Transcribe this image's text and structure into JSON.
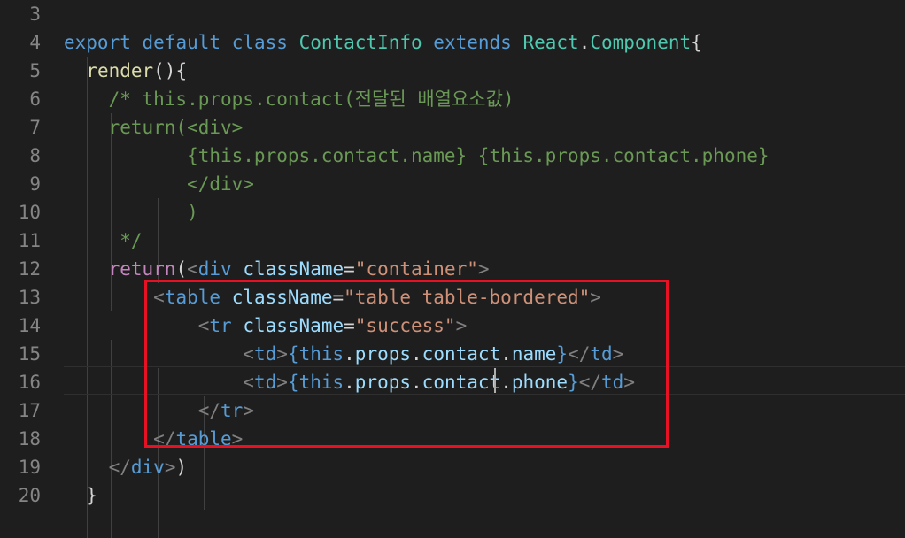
{
  "editor": {
    "lines": [
      {
        "num": "3",
        "tokens": []
      },
      {
        "num": "4",
        "tokens": [
          {
            "t": "export",
            "c": "kw"
          },
          {
            "t": " ",
            "c": "plain"
          },
          {
            "t": "default",
            "c": "kw"
          },
          {
            "t": " ",
            "c": "plain"
          },
          {
            "t": "class",
            "c": "kw"
          },
          {
            "t": " ",
            "c": "plain"
          },
          {
            "t": "ContactInfo",
            "c": "cls"
          },
          {
            "t": " ",
            "c": "plain"
          },
          {
            "t": "extends",
            "c": "kw"
          },
          {
            "t": " ",
            "c": "plain"
          },
          {
            "t": "React",
            "c": "cls"
          },
          {
            "t": ".",
            "c": "plain"
          },
          {
            "t": "Component",
            "c": "cls"
          },
          {
            "t": "{",
            "c": "plain"
          }
        ]
      },
      {
        "num": "5",
        "tokens": [
          {
            "t": "  ",
            "c": "plain"
          },
          {
            "t": "render",
            "c": "fn"
          },
          {
            "t": "(){",
            "c": "plain"
          }
        ]
      },
      {
        "num": "6",
        "tokens": [
          {
            "t": "    ",
            "c": "plain"
          },
          {
            "t": "/* this.props.contact(전달된 배열요소값)",
            "c": "cmt"
          }
        ]
      },
      {
        "num": "7",
        "tokens": [
          {
            "t": "    ",
            "c": "plain"
          },
          {
            "t": "return(<div>",
            "c": "cmt"
          }
        ]
      },
      {
        "num": "8",
        "tokens": [
          {
            "t": "           ",
            "c": "plain"
          },
          {
            "t": "{this.props.contact.name} {this.props.contact.phone}",
            "c": "cmt"
          }
        ]
      },
      {
        "num": "9",
        "tokens": [
          {
            "t": "           ",
            "c": "plain"
          },
          {
            "t": "</div>",
            "c": "cmt"
          }
        ]
      },
      {
        "num": "10",
        "tokens": [
          {
            "t": "           ",
            "c": "plain"
          },
          {
            "t": ")",
            "c": "cmt"
          }
        ]
      },
      {
        "num": "11",
        "tokens": [
          {
            "t": "     ",
            "c": "plain"
          },
          {
            "t": "*/",
            "c": "cmt"
          }
        ]
      },
      {
        "num": "12",
        "tokens": [
          {
            "t": "    ",
            "c": "plain"
          },
          {
            "t": "return",
            "c": "ctl"
          },
          {
            "t": "(",
            "c": "plain"
          },
          {
            "t": "<",
            "c": "tagp"
          },
          {
            "t": "div",
            "c": "tag"
          },
          {
            "t": " ",
            "c": "plain"
          },
          {
            "t": "className",
            "c": "attr"
          },
          {
            "t": "=",
            "c": "plain"
          },
          {
            "t": "\"container\"",
            "c": "str"
          },
          {
            "t": ">",
            "c": "tagp"
          }
        ]
      },
      {
        "num": "13",
        "tokens": [
          {
            "t": "        ",
            "c": "plain"
          },
          {
            "t": "<",
            "c": "tagp"
          },
          {
            "t": "table",
            "c": "tag"
          },
          {
            "t": " ",
            "c": "plain"
          },
          {
            "t": "className",
            "c": "attr"
          },
          {
            "t": "=",
            "c": "plain"
          },
          {
            "t": "\"table table-bordered\"",
            "c": "str"
          },
          {
            "t": ">",
            "c": "tagp"
          }
        ]
      },
      {
        "num": "14",
        "tokens": [
          {
            "t": "            ",
            "c": "plain"
          },
          {
            "t": "<",
            "c": "tagp"
          },
          {
            "t": "tr",
            "c": "tag"
          },
          {
            "t": " ",
            "c": "plain"
          },
          {
            "t": "className",
            "c": "attr"
          },
          {
            "t": "=",
            "c": "plain"
          },
          {
            "t": "\"success\"",
            "c": "str"
          },
          {
            "t": ">",
            "c": "tagp"
          }
        ]
      },
      {
        "num": "15",
        "tokens": [
          {
            "t": "                ",
            "c": "plain"
          },
          {
            "t": "<",
            "c": "tagp"
          },
          {
            "t": "td",
            "c": "tag"
          },
          {
            "t": ">",
            "c": "tagp"
          },
          {
            "t": "{",
            "c": "brace"
          },
          {
            "t": "this",
            "c": "kw"
          },
          {
            "t": ".",
            "c": "plain"
          },
          {
            "t": "props",
            "c": "attr"
          },
          {
            "t": ".",
            "c": "plain"
          },
          {
            "t": "contact",
            "c": "attr"
          },
          {
            "t": ".",
            "c": "plain"
          },
          {
            "t": "name",
            "c": "attr"
          },
          {
            "t": "}",
            "c": "brace"
          },
          {
            "t": "</",
            "c": "tagp"
          },
          {
            "t": "td",
            "c": "tag"
          },
          {
            "t": ">",
            "c": "tagp"
          }
        ]
      },
      {
        "num": "16",
        "tokens": [
          {
            "t": "                ",
            "c": "plain"
          },
          {
            "t": "<",
            "c": "tagp"
          },
          {
            "t": "td",
            "c": "tag"
          },
          {
            "t": ">",
            "c": "tagp"
          },
          {
            "t": "{",
            "c": "brace"
          },
          {
            "t": "this",
            "c": "kw"
          },
          {
            "t": ".",
            "c": "plain"
          },
          {
            "t": "props",
            "c": "attr"
          },
          {
            "t": ".",
            "c": "plain"
          },
          {
            "t": "contact",
            "c": "attr"
          },
          {
            "t": ".",
            "c": "plain"
          },
          {
            "t": "phone",
            "c": "attr"
          },
          {
            "t": "}",
            "c": "brace"
          },
          {
            "t": "</",
            "c": "tagp"
          },
          {
            "t": "td",
            "c": "tag"
          },
          {
            "t": ">",
            "c": "tagp"
          }
        ]
      },
      {
        "num": "17",
        "tokens": [
          {
            "t": "            ",
            "c": "plain"
          },
          {
            "t": "</",
            "c": "tagp"
          },
          {
            "t": "tr",
            "c": "tag"
          },
          {
            "t": ">",
            "c": "tagp"
          }
        ]
      },
      {
        "num": "18",
        "tokens": [
          {
            "t": "        ",
            "c": "plain"
          },
          {
            "t": "</",
            "c": "tagp"
          },
          {
            "t": "table",
            "c": "tag"
          },
          {
            "t": ">",
            "c": "tagp"
          }
        ]
      },
      {
        "num": "19",
        "tokens": [
          {
            "t": "    ",
            "c": "plain"
          },
          {
            "t": "</",
            "c": "tagp"
          },
          {
            "t": "div",
            "c": "tag"
          },
          {
            "t": ">",
            "c": "tagp"
          },
          {
            "t": ")",
            "c": "plain"
          }
        ]
      },
      {
        "num": "20",
        "tokens": [
          {
            "t": "  ",
            "c": "plain"
          },
          {
            "t": "}",
            "c": "plain"
          }
        ]
      }
    ]
  },
  "highlight_color": "#e81123",
  "theme": {
    "background": "#1e1e1e",
    "line_number": "#858585"
  }
}
